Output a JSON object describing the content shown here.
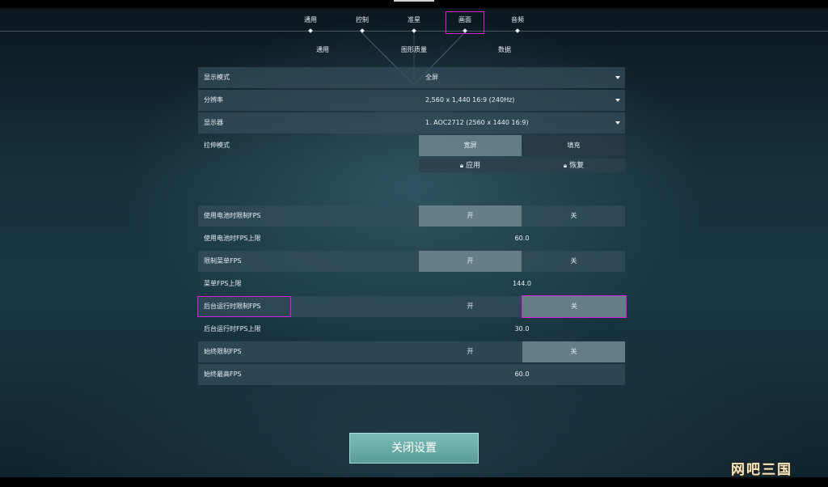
{
  "tabs": [
    {
      "label": "通用"
    },
    {
      "label": "控制"
    },
    {
      "label": "准星"
    },
    {
      "label": "画面",
      "active": true
    },
    {
      "label": "音频"
    }
  ],
  "subtabs": [
    {
      "label": "通用"
    },
    {
      "label": "图形质量"
    },
    {
      "label": "数据"
    }
  ],
  "display": {
    "mode_label": "显示模式",
    "mode_value": "全屏",
    "resolution_label": "分辨率",
    "resolution_value": "2,560 x 1,440 16:9 (240Hz)",
    "monitor_label": "显示器",
    "monitor_value": "1. AOC2712 (2560 x  1440 16:9)",
    "stretch_label": "拉伸模式",
    "stretch_option_1": "宽屏",
    "stretch_option_2": "填充",
    "apply_label": "应用",
    "restore_label": "恢复"
  },
  "fps": {
    "battery_limit_label": "使用电池时限制FPS",
    "battery_cap_label": "使用电池时FPS上限",
    "battery_cap_value": "60.0",
    "menu_limit_label": "限制菜单FPS",
    "menu_cap_label": "菜单FPS上限",
    "menu_cap_value": "144.0",
    "background_limit_label": "后台运行时限制FPS",
    "background_cap_label": "后台运行时FPS上限",
    "background_cap_value": "30.0",
    "always_limit_label": "始终限制FPS",
    "always_cap_label": "始终最高FPS",
    "always_cap_value": "60.0",
    "on_label": "开",
    "off_label": "关"
  },
  "close_button": "关闭设置",
  "watermark": "网吧三国",
  "colors": {
    "highlight": "#d21fdc",
    "close_button": "#6aaca6",
    "panel_row": "#344e5c"
  },
  "icons": {
    "lock": "lock-icon",
    "dropdown": "chevron-down-icon"
  }
}
